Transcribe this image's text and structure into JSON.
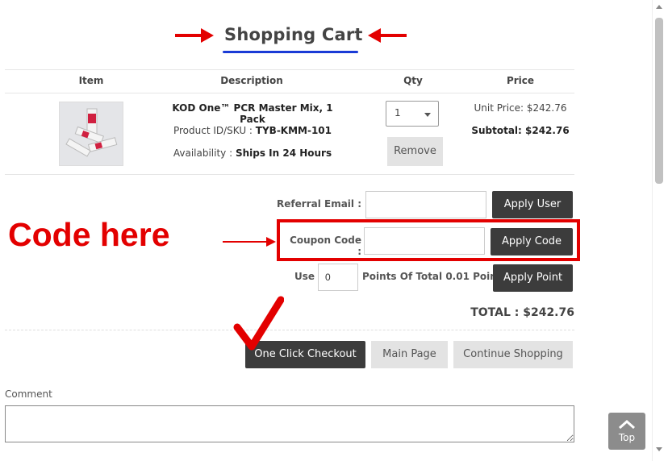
{
  "title": "Shopping Cart",
  "table": {
    "headers": [
      "Item",
      "Description",
      "Qty",
      "Price"
    ],
    "product": {
      "name": "KOD One™ PCR Master Mix, 1 Pack",
      "sku_label": "Product ID/SKU : ",
      "sku": "TYB-KMM-101",
      "availability_label": "Availability : ",
      "availability": "Ships In 24 Hours",
      "qty": "1",
      "remove_label": "Remove",
      "unit_price": "Unit Price: $242.76",
      "subtotal": "Subtotal: $242.76"
    }
  },
  "referral": {
    "label": "Referral Email :",
    "value": "",
    "button": "Apply User"
  },
  "coupon": {
    "label": "Coupon Code :",
    "value": "",
    "button": "Apply Code"
  },
  "points": {
    "use_label": "Use",
    "value": "0",
    "of_total": "Points Of Total 0.01 Points.",
    "button": "Apply Point"
  },
  "total": "TOTAL : $242.76",
  "annotation": {
    "code_here": "Code here"
  },
  "actions": {
    "checkout": "One Click Checkout",
    "main_page": "Main Page",
    "continue": "Continue Shopping"
  },
  "comment": {
    "label": "Comment",
    "value": ""
  },
  "top_button": "Top",
  "colors": {
    "annotation_red": "#e30000",
    "title_underline": "#1a3bd6",
    "dark_button": "#3c3c3c"
  }
}
